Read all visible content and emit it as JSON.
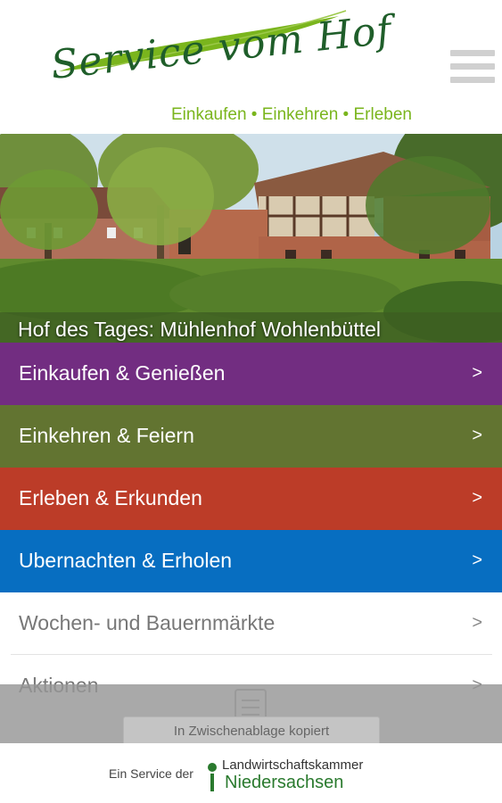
{
  "header": {
    "logo_title": "Service vom Hof",
    "logo_tagline": "Einkaufen • Einkehren • Erleben",
    "menu_icon": "hamburger-menu-icon"
  },
  "hero": {
    "caption": "Hof des Tages: Mühlenhof Wohlenbüttel"
  },
  "categories": [
    {
      "label": "Einkaufen & Genießen",
      "arrow": ">",
      "color": "#722d81"
    },
    {
      "label": "Einkehren & Feiern",
      "arrow": ">",
      "color": "#627431"
    },
    {
      "label": "Erleben & Erkunden",
      "arrow": ">",
      "color": "#bc3c28"
    },
    {
      "label": "Ubernachten & Erholen",
      "arrow": ">",
      "color": "#076ec1"
    }
  ],
  "list": [
    {
      "label": "Wochen- und Bauernmärkte",
      "arrow": ">"
    },
    {
      "label": "Aktionen",
      "arrow": ">"
    }
  ],
  "toast": {
    "text": "In Zwischenablage kopiert",
    "icon": "clipboard-icon"
  },
  "footer": {
    "prefix": "Ein Service der",
    "org_line1": "Landwirtschaftskammer",
    "org_line2": "Niedersachsen",
    "org_color": "#2a7a2e"
  }
}
